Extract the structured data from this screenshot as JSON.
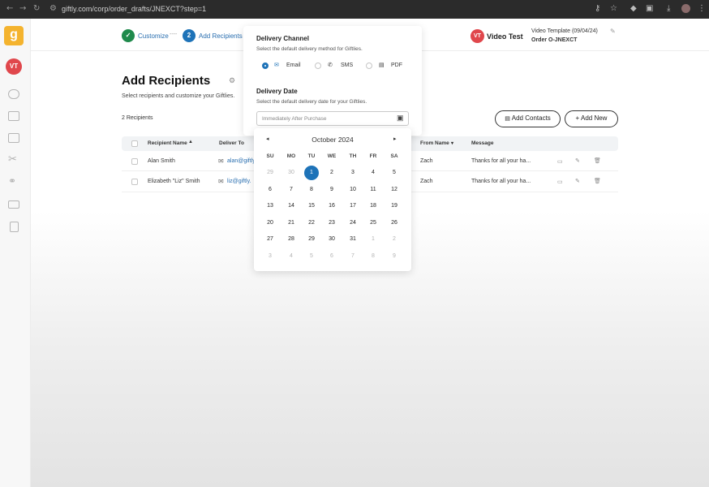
{
  "browser": {
    "url": "giftly.com/corp/order_drafts/JNEXCT?step=1"
  },
  "header": {
    "logo_letter": "g",
    "avatar_initials": "VT",
    "steps": [
      {
        "label": "Customize",
        "state": "done"
      },
      {
        "label": "Add Recipients",
        "number": "2",
        "state": "active"
      }
    ],
    "step_separator": "----",
    "user_initials": "VT",
    "user_name": "Video Test",
    "template_name": "Video Template (09/04/24)",
    "order_id": "Order O-JNEXCT"
  },
  "main": {
    "title": "Add Recipients",
    "subtitle": "Select recipients and customize your Giftlies.",
    "recipient_count": "2 Recipients",
    "add_contacts_label": "Add Contacts",
    "add_new_label": "+ Add New",
    "columns": {
      "name": "Recipient Name",
      "deliver_to": "Deliver To",
      "from": "From Name",
      "message": "Message"
    },
    "rows": [
      {
        "name": "Alan Smith",
        "email": "alan@giftly.",
        "from": "Zach",
        "message": "Thanks for all your ha..."
      },
      {
        "name": "Elizabeth \"Liz\" Smith",
        "email": "liz@giftly.",
        "from": "Zach",
        "message": "Thanks for all your ha..."
      }
    ]
  },
  "delivery": {
    "channel_title": "Delivery Channel",
    "channel_sub": "Select the default delivery method for Giftlies.",
    "options": [
      {
        "label": "Email",
        "selected": true,
        "icon": "envelope-icon"
      },
      {
        "label": "SMS",
        "selected": false,
        "icon": "phone-icon"
      },
      {
        "label": "PDF",
        "selected": false,
        "icon": "document-icon"
      }
    ],
    "date_title": "Delivery Date",
    "date_sub": "Select the default delivery date for your Giftlies.",
    "date_placeholder": "Immediately After Purchase"
  },
  "calendar": {
    "month_year": "October 2024",
    "weekdays": [
      "SU",
      "MO",
      "TU",
      "WE",
      "TH",
      "FR",
      "SA"
    ],
    "weeks": [
      [
        {
          "d": "29",
          "m": true
        },
        {
          "d": "30",
          "m": true
        },
        {
          "d": "1",
          "s": true
        },
        {
          "d": "2"
        },
        {
          "d": "3"
        },
        {
          "d": "4"
        },
        {
          "d": "5"
        }
      ],
      [
        {
          "d": "6"
        },
        {
          "d": "7"
        },
        {
          "d": "8"
        },
        {
          "d": "9"
        },
        {
          "d": "10"
        },
        {
          "d": "11"
        },
        {
          "d": "12"
        }
      ],
      [
        {
          "d": "13"
        },
        {
          "d": "14"
        },
        {
          "d": "15"
        },
        {
          "d": "16"
        },
        {
          "d": "17"
        },
        {
          "d": "18"
        },
        {
          "d": "19"
        }
      ],
      [
        {
          "d": "20"
        },
        {
          "d": "21"
        },
        {
          "d": "22"
        },
        {
          "d": "23"
        },
        {
          "d": "24"
        },
        {
          "d": "25"
        },
        {
          "d": "26"
        }
      ],
      [
        {
          "d": "27"
        },
        {
          "d": "28"
        },
        {
          "d": "29"
        },
        {
          "d": "30"
        },
        {
          "d": "31"
        },
        {
          "d": "1",
          "m": true
        },
        {
          "d": "2",
          "m": true
        }
      ],
      [
        {
          "d": "3",
          "m": true
        },
        {
          "d": "4",
          "m": true
        },
        {
          "d": "5",
          "m": true
        },
        {
          "d": "6",
          "m": true
        },
        {
          "d": "7",
          "m": true
        },
        {
          "d": "8",
          "m": true
        },
        {
          "d": "9",
          "m": true
        }
      ]
    ]
  },
  "colors": {
    "brand_yellow": "#f4b32e",
    "avatar_red": "#e0474c",
    "step_done_green": "#1f8a4c",
    "step_active_blue": "#1e73b8",
    "selected_blue": "#1e73b8"
  }
}
